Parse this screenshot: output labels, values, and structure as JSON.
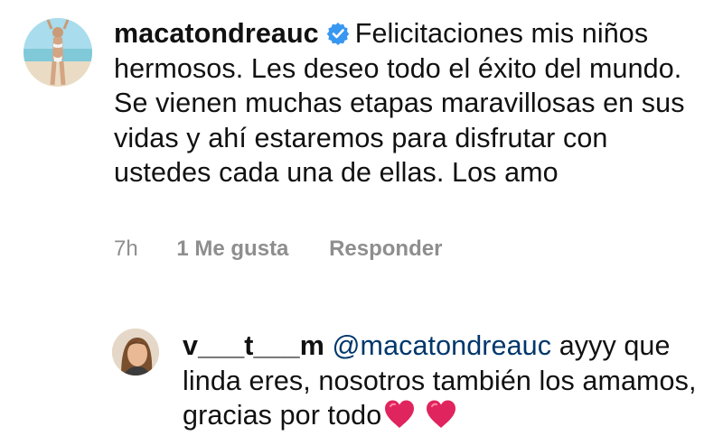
{
  "comment": {
    "username": "macatondreauc",
    "verified": true,
    "text": "Felicitaciones mis niños hermosos. Les deseo todo el éxito del mundo. Se vienen muchas etapas maravillosas en sus vidas y ahí estaremos para disfrutar con ustedes cada una de ellas.  Los amo",
    "time": "7h",
    "likes": "1 Me gusta",
    "reply_label": "Responder"
  },
  "reply": {
    "username": "v___t___m",
    "mention": "@macatondreauc",
    "text": "ayyy que linda eres, nosotros también los amamos, gracias por todo",
    "emoji": [
      "red-heart",
      "red-heart"
    ]
  },
  "colors": {
    "mention": "#00376b",
    "meta": "#8e8e8e",
    "verified": "#3897f0",
    "heart": "#e0245e"
  }
}
